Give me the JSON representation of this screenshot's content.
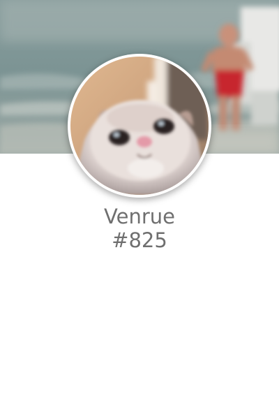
{
  "profile": {
    "username": "Venrue",
    "tag": "#825"
  },
  "images": {
    "cover": "blurred-beach-scene-with-child-in-red-shorts",
    "avatar": "white-kitten-looking-up-at-camera"
  },
  "colors": {
    "text": "#6f6f6f",
    "background": "#ffffff",
    "avatar_border": "#ffffff"
  }
}
